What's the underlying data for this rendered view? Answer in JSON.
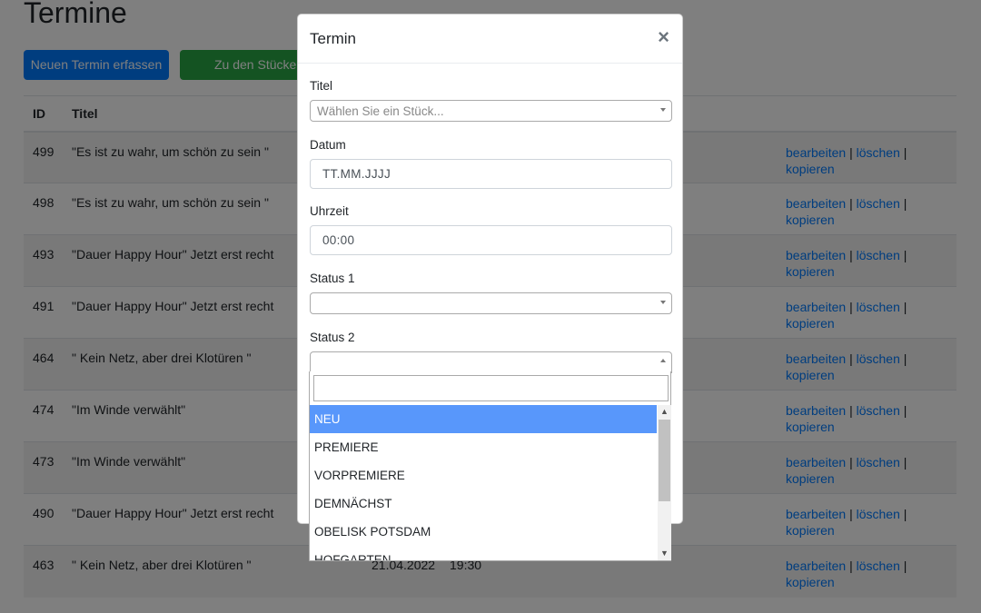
{
  "page": {
    "title": "Termine",
    "new_button": "Neuen Termin erfassen",
    "plays_button": "Zu den Stücken",
    "columns": {
      "id": "ID",
      "title": "Titel"
    },
    "rows": [
      {
        "id": "499",
        "title": "\"Es ist zu wahr, um schön zu sein \"",
        "date": "",
        "time": ""
      },
      {
        "id": "498",
        "title": "\"Es ist zu wahr, um schön zu sein \"",
        "date": "",
        "time": ""
      },
      {
        "id": "493",
        "title": "\"Dauer Happy Hour\" Jetzt erst recht",
        "date": "",
        "time": ""
      },
      {
        "id": "491",
        "title": "\"Dauer Happy Hour\" Jetzt erst recht",
        "date": "",
        "time": ""
      },
      {
        "id": "464",
        "title": "\" Kein Netz, aber drei Klotüren \"",
        "date": "",
        "time": ""
      },
      {
        "id": "474",
        "title": "\"Im Winde verwählt\"",
        "date": "",
        "time": ""
      },
      {
        "id": "473",
        "title": "\"Im Winde verwählt\"",
        "date": "",
        "time": ""
      },
      {
        "id": "490",
        "title": "\"Dauer Happy Hour\" Jetzt erst recht",
        "date": "",
        "time": ""
      },
      {
        "id": "463",
        "title": "\" Kein Netz, aber drei Klotüren \"",
        "date": "21.04.2022",
        "time": "19:30"
      }
    ],
    "actions": {
      "edit": "bearbeiten",
      "delete": "löschen",
      "copy": "kopieren",
      "sep": "|"
    }
  },
  "modal": {
    "title": "Termin",
    "close": "×",
    "titel_label": "Titel",
    "titel_placeholder": "Wählen Sie ein Stück...",
    "datum_label": "Datum",
    "datum_value": "TT.MM.JJJJ",
    "uhrzeit_label": "Uhrzeit",
    "uhrzeit_value": "00:00",
    "status1_label": "Status 1",
    "status2_label": "Status 2"
  },
  "dropdown": {
    "options": [
      "NEU",
      "PREMIERE",
      "VORPREMIERE",
      "DEMNÄCHST",
      "OBELISK POTSDAM",
      "HOFGARTEN"
    ],
    "highlighted": "NEU"
  },
  "colors": {
    "primary": "#007bff",
    "success": "#28a745",
    "highlight": "#5897fb"
  }
}
